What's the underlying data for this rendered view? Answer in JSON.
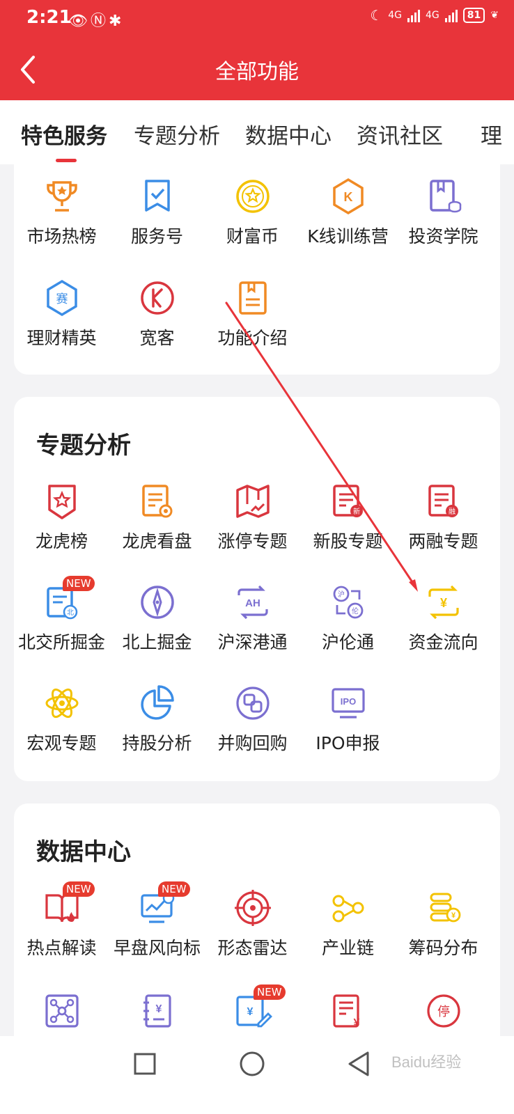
{
  "status_bar": {
    "time": "2:21",
    "signal1": "4G",
    "signal2": "4G",
    "battery": "81"
  },
  "header": {
    "title": "全部功能"
  },
  "tabs": [
    "特色服务",
    "专题分析",
    "数据中心",
    "资讯社区",
    "理"
  ],
  "featured": {
    "items": [
      {
        "label": "市场热榜",
        "icon": "trophy-icon"
      },
      {
        "label": "服务号",
        "icon": "bookmark-check-icon"
      },
      {
        "label": "财富币",
        "icon": "coin-icon"
      },
      {
        "label": "K线训练营",
        "icon": "k-hexagon-icon"
      },
      {
        "label": "投资学院",
        "icon": "book-icon"
      },
      {
        "label": "理财精英",
        "icon": "sai-hexagon-icon",
        "glyph": "赛"
      },
      {
        "label": "宽客",
        "icon": "k-circle-icon"
      },
      {
        "label": "功能介绍",
        "icon": "document-icon"
      }
    ]
  },
  "topics": {
    "title": "专题分析",
    "items": [
      {
        "label": "龙虎榜",
        "icon": "shield-star-icon"
      },
      {
        "label": "龙虎看盘",
        "icon": "document-medal-icon"
      },
      {
        "label": "涨停专题",
        "icon": "map-chart-icon"
      },
      {
        "label": "新股专题",
        "icon": "document-new-icon",
        "glyph": "新"
      },
      {
        "label": "两融专题",
        "icon": "document-margin-icon",
        "glyph": "融"
      },
      {
        "label": "北交所掘金",
        "icon": "document-bei-icon",
        "badge": "NEW",
        "glyph": "北"
      },
      {
        "label": "北上掘金",
        "icon": "compass-icon"
      },
      {
        "label": "沪深港通",
        "icon": "ah-exchange-icon",
        "glyph": "AH"
      },
      {
        "label": "沪伦通",
        "icon": "hu-lun-icon",
        "glyph": "沪",
        "glyph2": "伦"
      },
      {
        "label": "资金流向",
        "icon": "yuan-exchange-icon",
        "glyph": "¥"
      },
      {
        "label": "宏观专题",
        "icon": "atom-icon"
      },
      {
        "label": "持股分析",
        "icon": "pie-chart-icon"
      },
      {
        "label": "并购回购",
        "icon": "merge-icon"
      },
      {
        "label": "IPO申报",
        "icon": "ipo-screen-icon",
        "glyph": "IPO"
      }
    ]
  },
  "data_center": {
    "title": "数据中心",
    "items": [
      {
        "label": "热点解读",
        "icon": "book-fire-icon",
        "badge": "NEW"
      },
      {
        "label": "早盘风向标",
        "icon": "monitor-chart-icon",
        "badge": "NEW"
      },
      {
        "label": "形态雷达",
        "icon": "radar-icon"
      },
      {
        "label": "产业链",
        "icon": "chain-nodes-icon"
      },
      {
        "label": "筹码分布",
        "icon": "coin-stack-icon",
        "glyph": "¥"
      },
      {
        "label": "",
        "icon": "network-icon"
      },
      {
        "label": "",
        "icon": "ledger-yuan-icon",
        "glyph": "¥"
      },
      {
        "label": "",
        "icon": "edit-yuan-icon",
        "badge": "NEW",
        "glyph": "¥"
      },
      {
        "label": "",
        "icon": "doc-yuan-icon",
        "glyph": "¥"
      },
      {
        "label": "",
        "icon": "suspend-circle-icon",
        "glyph": "停"
      }
    ]
  },
  "watermark": "Baidu经验",
  "colors": {
    "brand": "#e8343a",
    "orange": "#f08a24",
    "blue": "#3b8de6",
    "purple": "#7b6fd0",
    "red": "#d9363e",
    "yellow": "#f3c200"
  }
}
